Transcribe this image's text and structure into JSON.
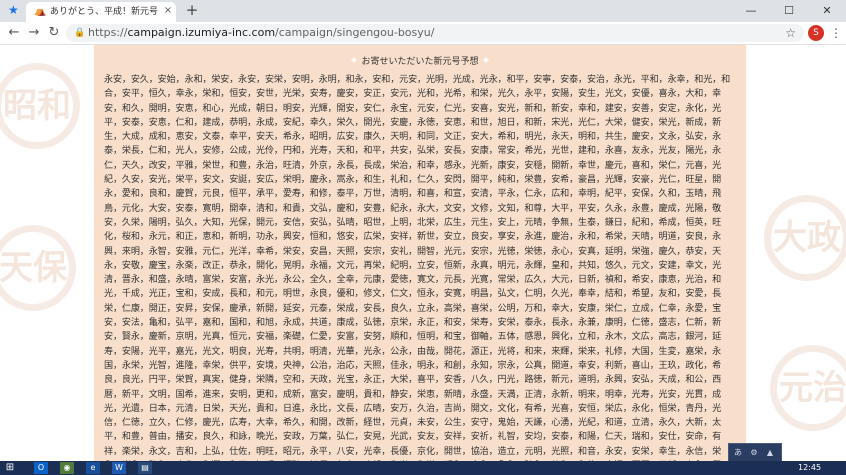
{
  "browser": {
    "tab_title": "ありがとう、平成！新元号予想キャ",
    "url_prefix": "https://",
    "url_host": "campaign.izumiya-inc.com",
    "url_path": "/campaign/singengou-bosyu/",
    "profile_initial": "S",
    "new_tab": "+",
    "close_tab": "×",
    "window": {
      "minimize": "—",
      "maximize": "☐",
      "close": "✕"
    }
  },
  "colors": {
    "panel_bg": "#f8dfcb",
    "taskbar": "#1b2f55",
    "profile": "#d93025"
  },
  "page": {
    "heading": "お寄せいただいた新元号予想",
    "decorations": {
      "seal_left_top": "昭和",
      "seal_left_bottom": "天保",
      "seal_right_mid": "大政",
      "seal_right_bottom": "元治"
    },
    "names_text": "永安，安久，安始，永和，栄安，永安，安栄，安明，永明，和永，安和，元安，光明，光成，光永，和平，安寧，安泰，安治，永光，平和，永幸，和光，和合，安平，恒久，幸永，栄和，恒安，安世，光栄，安寿，慶安，安正，安元，光和，光希，和栄，光久，永平，安陽，安生，光文，安優，喜永，大和，幸安，和久，開明，安恵，和心，光成，朝日，明安，光輝，開安，安仁，永宝，元安，仁光，安喜，安光，新和，新安，幸和，建安，安善，安定，永化，光平，安泰，安恵，仁和，建成，恭明，永成，安紀，幸久，栄久，開光，安慶，永徳，安恵，和世，旭日，和新，宋光，光仁，大栄，健安，栄光，新成，新生，大成，成和，恵安，文泰，幸平，安天，希永，昭明，広安，康久，天明，和同，文正，安大，希和，明光，永天，明和，共生，慶安，文永，弘安，永泰，栄長，仁和，光人，安修，公成，光伶，円和，光寿，天和，和平，共安，弘栄，安長，安康，常安，希光，光世，建和，永喜，友永，光友，陽光，永仁，天久，改安，平雅，栄世，和豊，永治，旺清，外京，永長，長成，栄治，和幸，感永，光新，康安，安穏，開新，幸世，慶元，喜和，栄仁，元喜，光紀，久安，安光，栄平，安文，安誕，安広，栄明，慶永，嵩永，和生，礼和，仁久，安閃，開平，純和，栄豊，安希，豪昌，光輝，安豪，光仁，旺星，開永，愛和，良和，慶賀，元良，恒平，承平，愛寿，和修，泰平，万世，清明，和喜，和宣，安清，平永，仁永，広和，幸明，紀平，安保，久和，玉晴，飛鳥，元化，大安，安泰，寛明，開幸，清和，和貴，文弘，慶和，安豊，紀永，永大，文安，文修，文知，和尊，大平，平安，久永，永豊，慶成，光陽，敬安，久栄，陽明，弘久，大知，光保，開元，安信，安弘，弘晴，昭世，上明，北栄，広生，元生，安上，元晴，争無，生泰，鎌日，紀和，希成，恒英，旺化，桜和，永元，和正，恵和，新明，功永，興安，恒和，悠安，広栄，安祥，新世，安立，良安，享安，永進，慶治，永和，希栄，天晴，明道，安良，永興，来明，永智，安雅，元仁，光洋，幸希，栄安，安昌，天照，安宗，安礼，開智，光元，安宗，光徳，栄徳，永心，安真，延明，栄強，慶久，恭安，天永，安敬，慶宝，永楽，改正，恭永，開化，晃明，永福，文元，再栄，紀明，立安，恒新，永真，明元，永輝，皇和，共知，悠久，元文，安建，幸文，光清，晋永，和盛，永晴，富栄，安富，永光，永公，全久，全幸，元康，愛徳，寛文，元長，光寛，常栄，広久，大元，日新，禎和，希安，康恵，光治，和光，千成，光正，宝和，安成，長和，和元，明世，永良，優和，修文，仁文，恒永，安寛，明昌，弘文，仁明，久光，奉幸，結和，希望，友和，安愛，長栄，仁康，開正，安昇，安保，慶承，新開，延安，元泰，栄成，安長，良久，立永，高栄，喜栄，公明，万和，幸大，安康，栄仁，立成，仁幸，永愛，宝安，安法，亀和，弘平，嘉和，国和，和旭，永成，共道，康成，弘徳，京栄，永正，和安，栄寿，安栄，泰永，長永，永兼，康明，仁徳，盛志，仁新，新安，賢永，慶新，京明，光真，恒元，安福，楽礎，仁愛，安富，安努，順和，恒明，和宝，御軸，五体，感恩，興化，立和，永木，文広，高志，銀河，延寿，安陽，光平，嘉光，光文，明良，光寿，共明，明清，光華，光永，公永，由哉，開花，源正，光将，和来，来輝，栄来，礼修，大国，生変，嘉栄，永国，永栄，光智，進隆，幸栄，供平，安境，央神，公治，治応，天照，佳永，明永，和創，永知，宗永，公真，開道，幸安，利新，喜山，王玖，政化，希良，良光，円平，栄賀，真実，健身，栄隣，空和，天政，光宝，永正，大栄，喜平，安香，八久，円光，路徳，新元，道明，永興，安弘，天成，和公，西暦，新平，文明，国希，進来，安明，更和，成新，富安，慶明，貴和，静安，栄恵，新晴，永盛，天満，正清，永新，明来，明幸，光寿，光安，光貫，成光，光遺，日本，元清，日栄，天光，貴和，日進，永比，文長，広晴，安万，久治，吉尚，開文，文化，有希，光喜，安恒，栄広，永化，恒栄，青丹，光信，仁徳，立久，仁修，慶光，広寿，大幸，希久，和開，改新，経世，元貞，未安，公生，安守，鬼始，天謙，心湧，光紀，和道，立清，永久，大新，太平，和豊，普由，播安，良久，和詠，晩光，安政，万葉，弘仁，安晃，光武，安友，安祥，安祈，礼智，安均，安泰，和陽，仁天，瑞和，安仕，安命，有祥，楽栄，永文，吉和，上弘，仕佐，明旺，昭元，永平，八安，光幸，長優，京化，開世，協治，造立，元明，光照，和音，永安，安栄，幸生，永信，栄永，光永，弘和，慶豊，和翔，和天，知明，恒弘，証保，仁寿，慶望，和光，和栄，明永，皇永，亀永，弘永，啓和，和信，幸福，国匡，正新，寿永，興起，永志，泰久，桂光，永恭，寛成，豊寿，愛光，民正，恍和，進和，和和，弘永，五輪，五大，令永，光和，未来，祥和，至安，大安，東愛，永爆，恒明，光仁，恒和，佳世，貴安，永明，永山，日花，吉祥，開輝，栄大，青平，寛寿，和雅，永誠，安禄，元治，栄楽，友功，友安，慶賀，開成，寿久，友展，慶帝，保歴，大大，文功，惠和，富葵，栄，快明，泳新，寛栄，吉安，寿光，仁永，日宏，安成，安明，今泰，庸之，光志，青年，大文，永幸，光暁，全好，和平，皇永，安太，光盛，永栄，光明，安光，永明"
  },
  "taskbar": {
    "apps": [
      "Outlook",
      "Chrome",
      "Edge",
      "Word"
    ],
    "tray": [
      "あ",
      "⚙",
      "▲"
    ],
    "time": "12:45"
  }
}
